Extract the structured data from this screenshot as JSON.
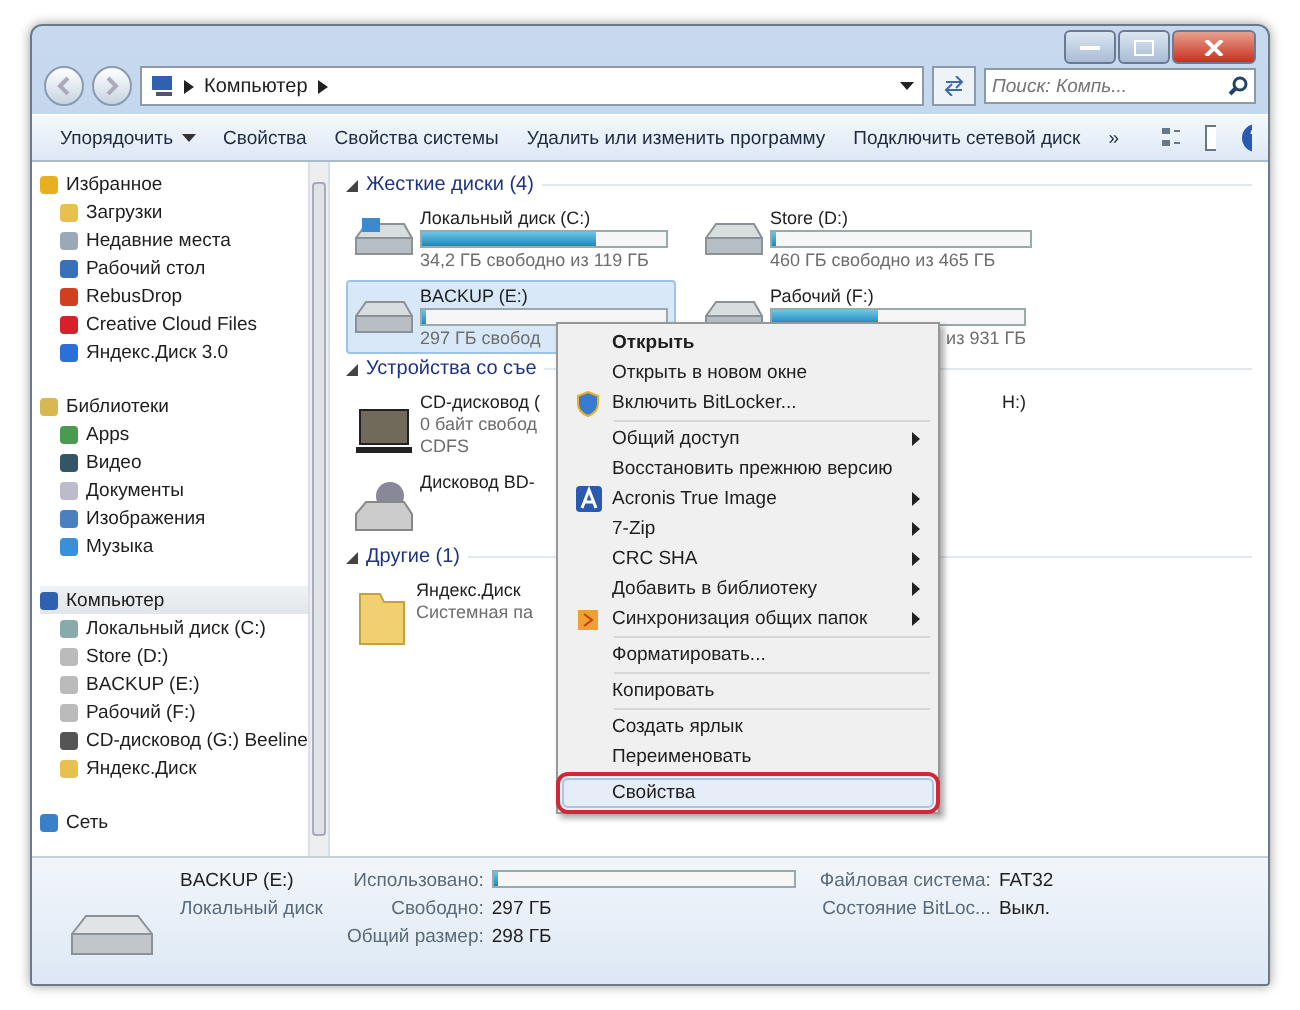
{
  "address": {
    "crumbs": [
      "Компьютер"
    ],
    "search_placeholder": "Поиск: Компь..."
  },
  "toolbar": {
    "items": [
      "Упорядочить",
      "Свойства",
      "Свойства системы",
      "Удалить или изменить программу",
      "Подключить сетевой диск"
    ],
    "more": "»"
  },
  "sidebar": {
    "groups": [
      {
        "label": "Избранное",
        "selected": false,
        "children": [
          {
            "label": "Загрузки"
          },
          {
            "label": "Недавние места"
          },
          {
            "label": "Рабочий стол"
          },
          {
            "label": "RebusDrop"
          },
          {
            "label": "Creative Cloud Files"
          },
          {
            "label": "Яндекс.Диск 3.0"
          }
        ]
      },
      {
        "label": "Библиотеки",
        "selected": false,
        "children": [
          {
            "label": "Apps"
          },
          {
            "label": "Видео"
          },
          {
            "label": "Документы"
          },
          {
            "label": "Изображения"
          },
          {
            "label": "Музыка"
          }
        ]
      },
      {
        "label": "Компьютер",
        "selected": true,
        "children": [
          {
            "label": "Локальный диск (C:)"
          },
          {
            "label": "Store (D:)"
          },
          {
            "label": "BACKUP (E:)"
          },
          {
            "label": "Рабочий (F:)"
          },
          {
            "label": "CD-дисковод (G:) Beeline"
          },
          {
            "label": "Яндекс.Диск"
          }
        ]
      },
      {
        "label": "Сеть",
        "selected": false
      }
    ]
  },
  "sections": [
    {
      "title": "Жесткие диски (4)",
      "items": [
        {
          "kind": "system-drive",
          "name": "Локальный диск (C:)",
          "level": 0.71,
          "selected": false,
          "lines": [
            "34,2 ГБ свободно из 119 ГБ"
          ]
        },
        {
          "kind": "drive",
          "name": "Store (D:)",
          "level": 0.01,
          "selected": false,
          "lines": [
            "460 ГБ свободно из 465 ГБ"
          ]
        },
        {
          "kind": "drive",
          "name": "BACKUP (E:)",
          "level": 0.0,
          "selected": true,
          "lines": [
            "297 ГБ свобод"
          ]
        },
        {
          "kind": "drive-tail",
          "name": "Рабочий (F:)",
          "level": 0.42,
          "selected": false,
          "lines": [
            "из 931 ГБ"
          ]
        }
      ]
    },
    {
      "title": "Устройства со съе",
      "items": [
        {
          "kind": "optical",
          "name": "CD-дисковод (",
          "selected": false,
          "lines": [
            "0 байт свобод",
            "CDFS"
          ]
        },
        {
          "kind": "tail",
          "name": "Н:)",
          "selected": false
        },
        {
          "kind": "bluray",
          "name": "Дисковод BD-",
          "selected": false
        }
      ]
    },
    {
      "title": "Другие (1)",
      "items": [
        {
          "kind": "folder",
          "name": "Яндекс.Диск",
          "selected": false,
          "lines": [
            "Системная па"
          ]
        }
      ]
    }
  ],
  "context_menu": [
    {
      "kind": "plain",
      "label": "Открыть",
      "bold": true,
      "submenu": false,
      "selected": false
    },
    {
      "kind": "plain",
      "label": "Открыть в новом окне",
      "bold": false,
      "submenu": false,
      "selected": false
    },
    {
      "kind": "shield",
      "label": "Включить BitLocker...",
      "bold": false,
      "submenu": false,
      "selected": false
    },
    {
      "kind": "separator"
    },
    {
      "kind": "plain",
      "label": "Общий доступ",
      "bold": false,
      "submenu": true,
      "selected": false
    },
    {
      "kind": "plain",
      "label": "Восстановить прежнюю версию",
      "bold": false,
      "submenu": false,
      "selected": false
    },
    {
      "kind": "acronis",
      "label": "Acronis True Image",
      "bold": false,
      "submenu": true,
      "selected": false
    },
    {
      "kind": "plain",
      "label": "7-Zip",
      "bold": false,
      "submenu": true,
      "selected": false
    },
    {
      "kind": "plain",
      "label": "CRC SHA",
      "bold": false,
      "submenu": true,
      "selected": false
    },
    {
      "kind": "plain",
      "label": "Добавить в библиотеку",
      "bold": false,
      "submenu": true,
      "selected": false
    },
    {
      "kind": "sync",
      "label": "Синхронизация общих папок",
      "bold": false,
      "submenu": true,
      "selected": false
    },
    {
      "kind": "separator"
    },
    {
      "kind": "plain",
      "label": "Форматировать...",
      "bold": false,
      "submenu": false,
      "selected": false
    },
    {
      "kind": "separator"
    },
    {
      "kind": "plain",
      "label": "Копировать",
      "bold": false,
      "submenu": false,
      "selected": false
    },
    {
      "kind": "separator"
    },
    {
      "kind": "plain",
      "label": "Создать ярлык",
      "bold": false,
      "submenu": false,
      "selected": false
    },
    {
      "kind": "plain",
      "label": "Переименовать",
      "bold": false,
      "submenu": false,
      "selected": false
    },
    {
      "kind": "separator"
    },
    {
      "kind": "plain",
      "label": "Свойства",
      "bold": false,
      "submenu": false,
      "selected": true
    }
  ],
  "details": {
    "name": "BACKUP (E:)",
    "type": "Локальный диск",
    "used_label": "Использовано:",
    "level": 0.0,
    "fields": [
      {
        "label": "Свободно:",
        "value": "297 ГБ"
      },
      {
        "label": "Общий размер:",
        "value": "298 ГБ"
      }
    ],
    "extra": [
      {
        "label": "Файловая система:",
        "value": "FAT32"
      },
      {
        "label": "Состояние BitLoc...",
        "value": "Выкл."
      }
    ]
  }
}
